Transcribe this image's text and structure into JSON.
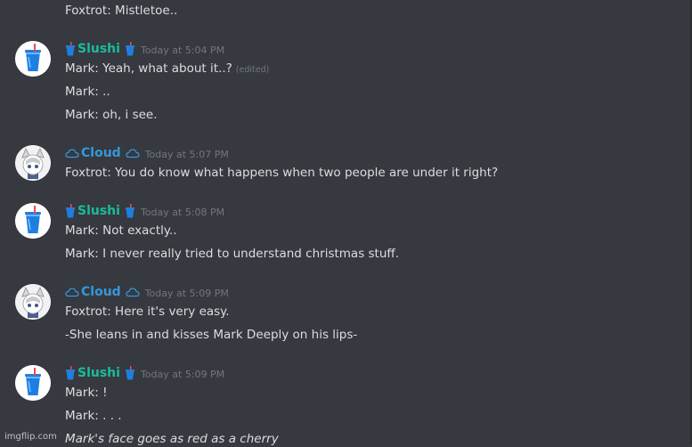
{
  "colors": {
    "background": "#36393f",
    "slushi_name": "#1abc9c",
    "cloud_name": "#3498db",
    "message_text": "#dcddde",
    "timestamp": "#72767d"
  },
  "icons": {
    "slushi_badge": "cup-with-straw-icon",
    "cloud_badge": "cloud-icon"
  },
  "messages": [
    {
      "text": "Foxtrot: Mistletoe.."
    },
    {
      "author": "Slushi",
      "timestamp": "Today at 5:04 PM",
      "lines": [
        {
          "text": "Mark: Yeah, what about it..?",
          "edited": "(edited)"
        },
        {
          "text": "Mark: .."
        },
        {
          "text": "Mark: oh, i see."
        }
      ]
    },
    {
      "author": "Cloud",
      "timestamp": "Today at 5:07 PM",
      "lines": [
        {
          "text": "Foxtrot:  You do know what happens when two people are under it right?"
        }
      ]
    },
    {
      "author": "Slushi",
      "timestamp": "Today at 5:08 PM",
      "lines": [
        {
          "text": "Mark: Not exactly.."
        },
        {
          "text": "Mark: I never really tried to understand christmas stuff."
        }
      ]
    },
    {
      "author": "Cloud",
      "timestamp": "Today at 5:09 PM",
      "lines": [
        {
          "text": "Foxtrot: Here it's very easy."
        },
        {
          "text": "-She leans in and kisses Mark Deeply on his lips-"
        }
      ]
    },
    {
      "author": "Slushi",
      "timestamp": "Today at 5:09 PM",
      "lines": [
        {
          "text": "Mark: !"
        },
        {
          "text": "Mark: . . ."
        },
        {
          "text": "Mark's face goes as red as a cherry"
        }
      ]
    }
  ],
  "watermark": "imgflip.com"
}
